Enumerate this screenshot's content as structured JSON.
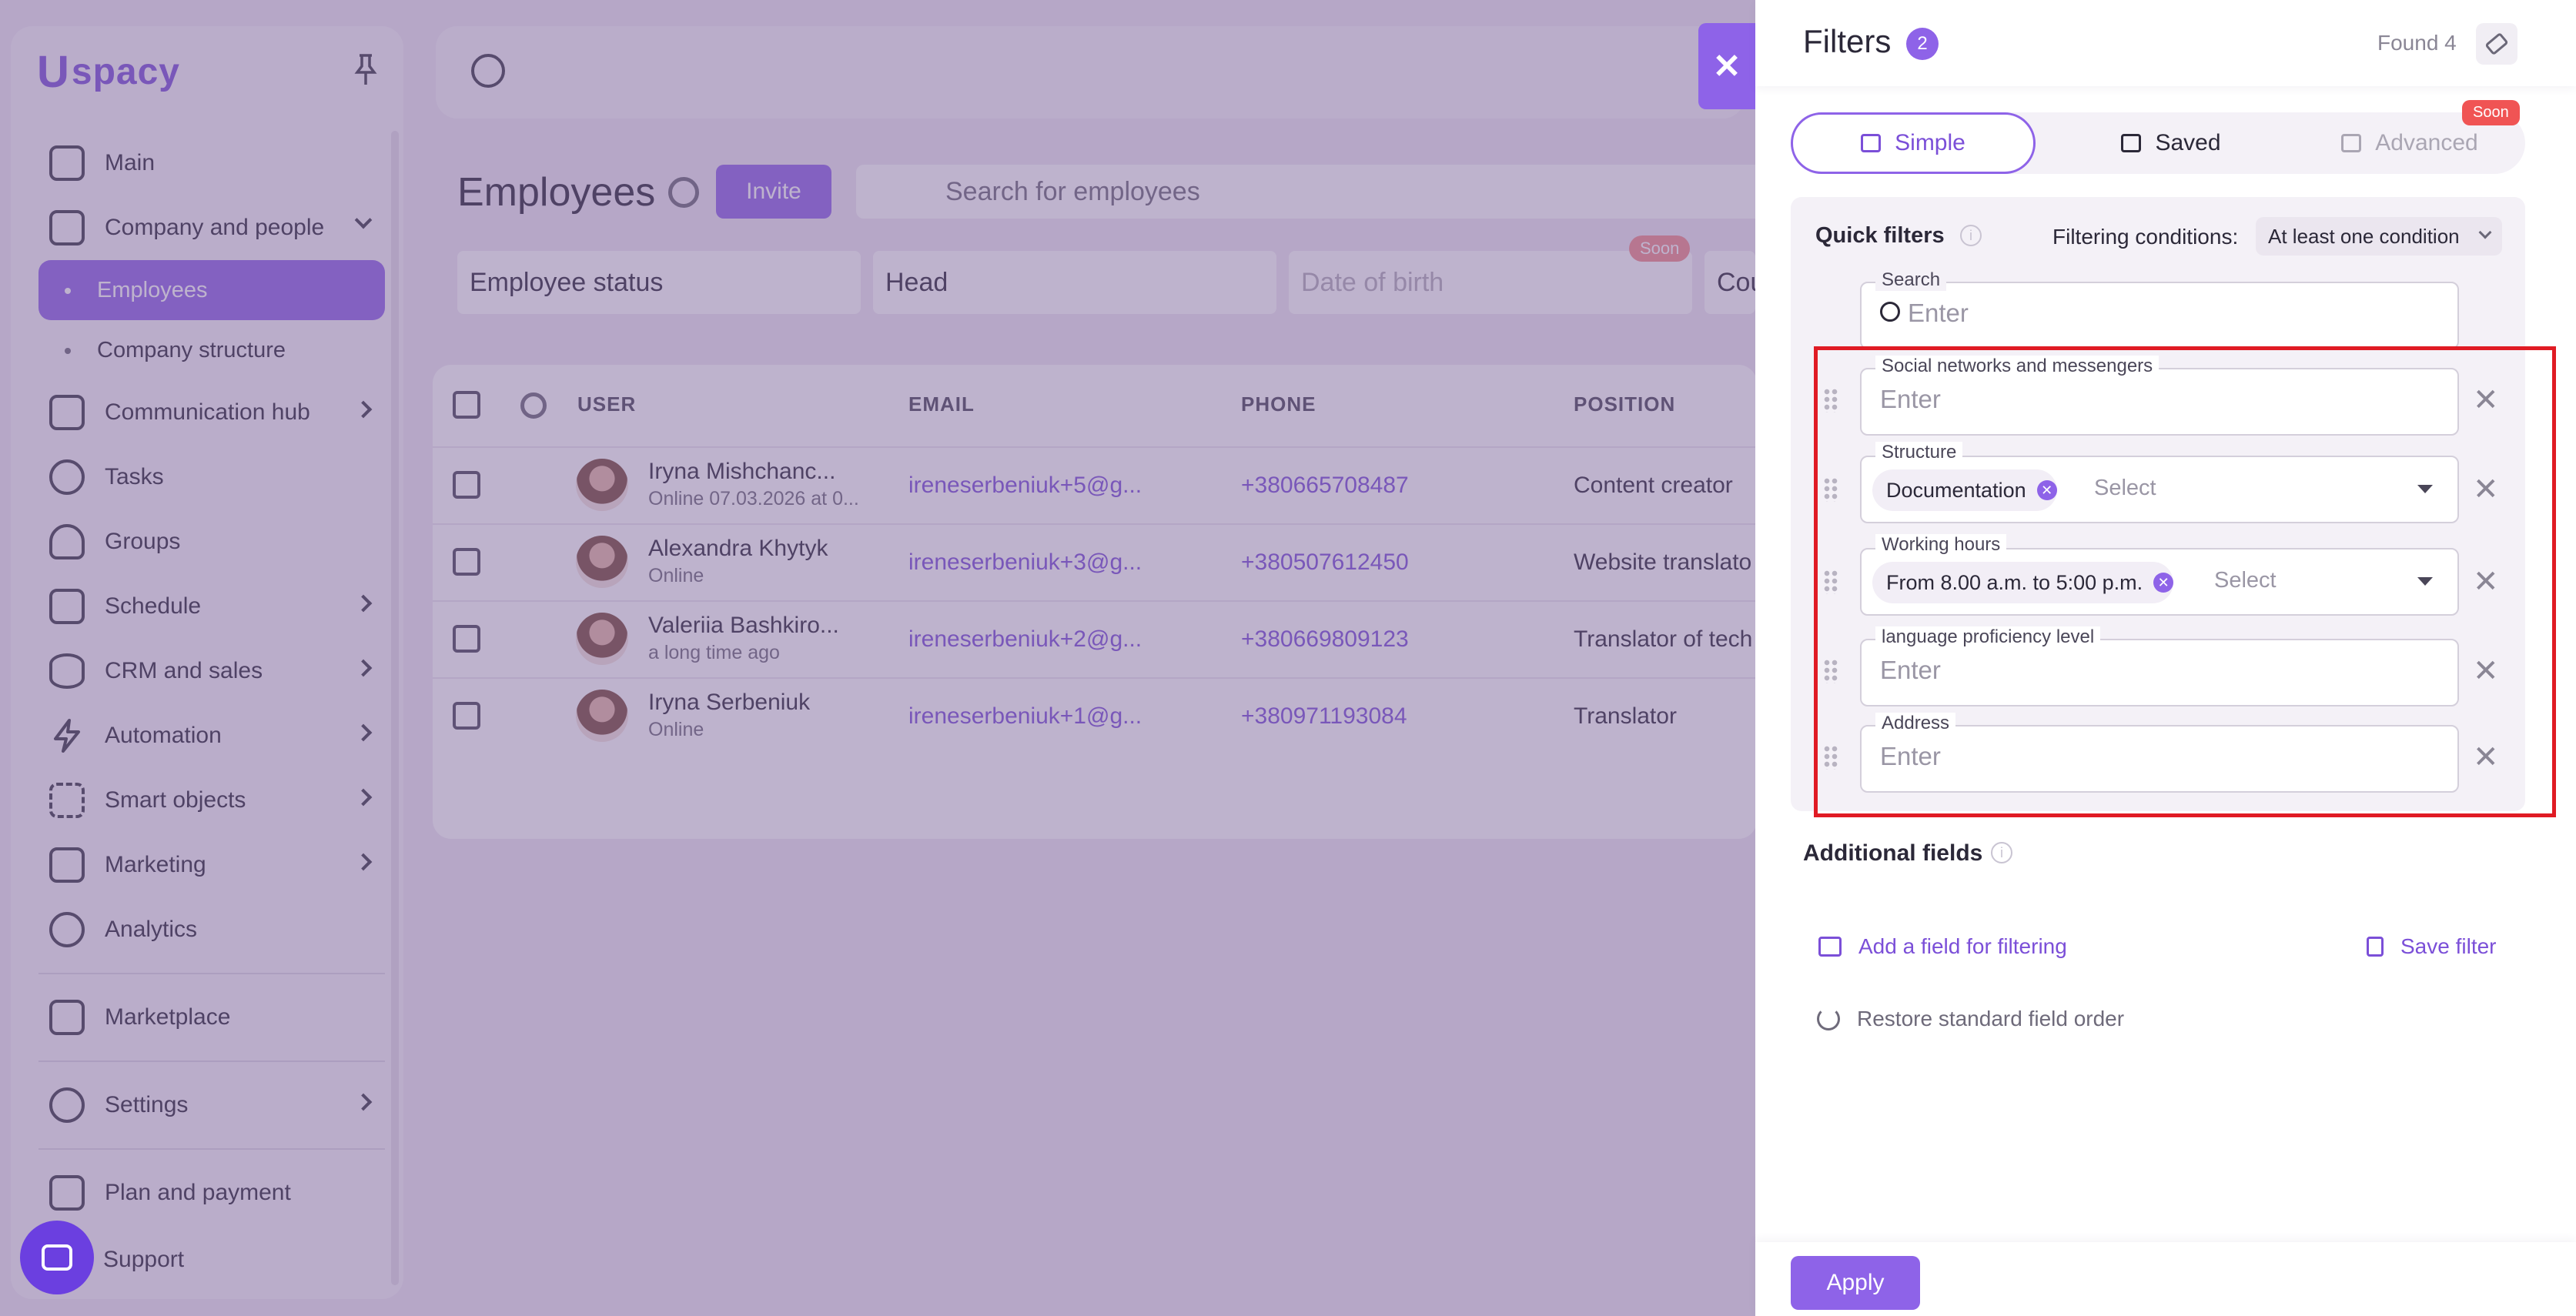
{
  "app": {
    "logo_text": "spacy",
    "logo_letter": "U",
    "accent_color": "#8e63e8"
  },
  "sidebar": {
    "items": [
      {
        "label": "Main",
        "icon": "home-icon"
      },
      {
        "label": "Company and people",
        "icon": "building-icon"
      },
      {
        "label": "Employees",
        "icon": "dot"
      },
      {
        "label": "Company structure",
        "icon": "dot"
      },
      {
        "label": "Communication hub",
        "icon": "chat-icon"
      },
      {
        "label": "Tasks",
        "icon": "check-circle-icon"
      },
      {
        "label": "Groups",
        "icon": "users-icon"
      },
      {
        "label": "Schedule",
        "icon": "calendar-icon"
      },
      {
        "label": "CRM and sales",
        "icon": "database-icon"
      },
      {
        "label": "Automation",
        "icon": "lightning-icon"
      },
      {
        "label": "Smart objects",
        "icon": "scan-icon"
      },
      {
        "label": "Marketing",
        "icon": "megaphone-icon"
      },
      {
        "label": "Analytics",
        "icon": "chart-icon"
      },
      {
        "label": "Marketplace",
        "icon": "store-icon"
      },
      {
        "label": "Settings",
        "icon": "gear-icon"
      },
      {
        "label": "Plan and payment",
        "icon": "wallet-icon"
      },
      {
        "label": "Support",
        "icon": "support-icon"
      }
    ]
  },
  "employees": {
    "title": "Employees",
    "invite_label": "Invite",
    "search_placeholder": "Search for employees",
    "filters": [
      "Employee status",
      "Head",
      "Date of birth",
      "Cou"
    ],
    "soon_label": "Soon",
    "columns": [
      "USER",
      "EMAIL",
      "PHONE",
      "POSITION"
    ],
    "rows": [
      {
        "name": "Iryna Mishchanc...",
        "status": "Online 07.03.2026 at 0...",
        "email": "ireneserbeniuk+5@g...",
        "phone": "+380665708487",
        "position": "Content creator"
      },
      {
        "name": "Alexandra Khytyk",
        "status": "Online",
        "email": "ireneserbeniuk+3@g...",
        "phone": "+380507612450",
        "position": "Website translato"
      },
      {
        "name": "Valeriia Bashkiro...",
        "status": "a long time ago",
        "email": "ireneserbeniuk+2@g...",
        "phone": "+380669809123",
        "position": "Translator of tech"
      },
      {
        "name": "Iryna Serbeniuk",
        "status": "Online",
        "email": "ireneserbeniuk+1@g...",
        "phone": "+380971193084",
        "position": "Translator"
      }
    ]
  },
  "filters_panel": {
    "title": "Filters",
    "count": "2",
    "found_label": "Found 4",
    "tabs": {
      "simple": "Simple",
      "saved": "Saved",
      "advanced": "Advanced",
      "soon": "Soon"
    },
    "quick_filters_title": "Quick filters",
    "conditions_label": "Filtering conditions:",
    "conditions_value": "At least one condition",
    "fields": {
      "search": {
        "label": "Search",
        "placeholder": "Enter"
      },
      "social": {
        "label": "Social networks and messengers",
        "placeholder": "Enter"
      },
      "structure": {
        "label": "Structure",
        "chip": "Documentation",
        "placeholder": "Select"
      },
      "working_hours": {
        "label": "Working hours",
        "chip": "From 8.00 a.m. to 5:00 p.m.",
        "placeholder": "Select"
      },
      "language": {
        "label": "language proficiency level",
        "placeholder": "Enter"
      },
      "address": {
        "label": "Address",
        "placeholder": "Enter"
      }
    },
    "additional_fields_title": "Additional fields",
    "add_field_label": "Add a field for filtering",
    "save_filter_label": "Save filter",
    "restore_label": "Restore standard field order",
    "apply_label": "Apply"
  }
}
